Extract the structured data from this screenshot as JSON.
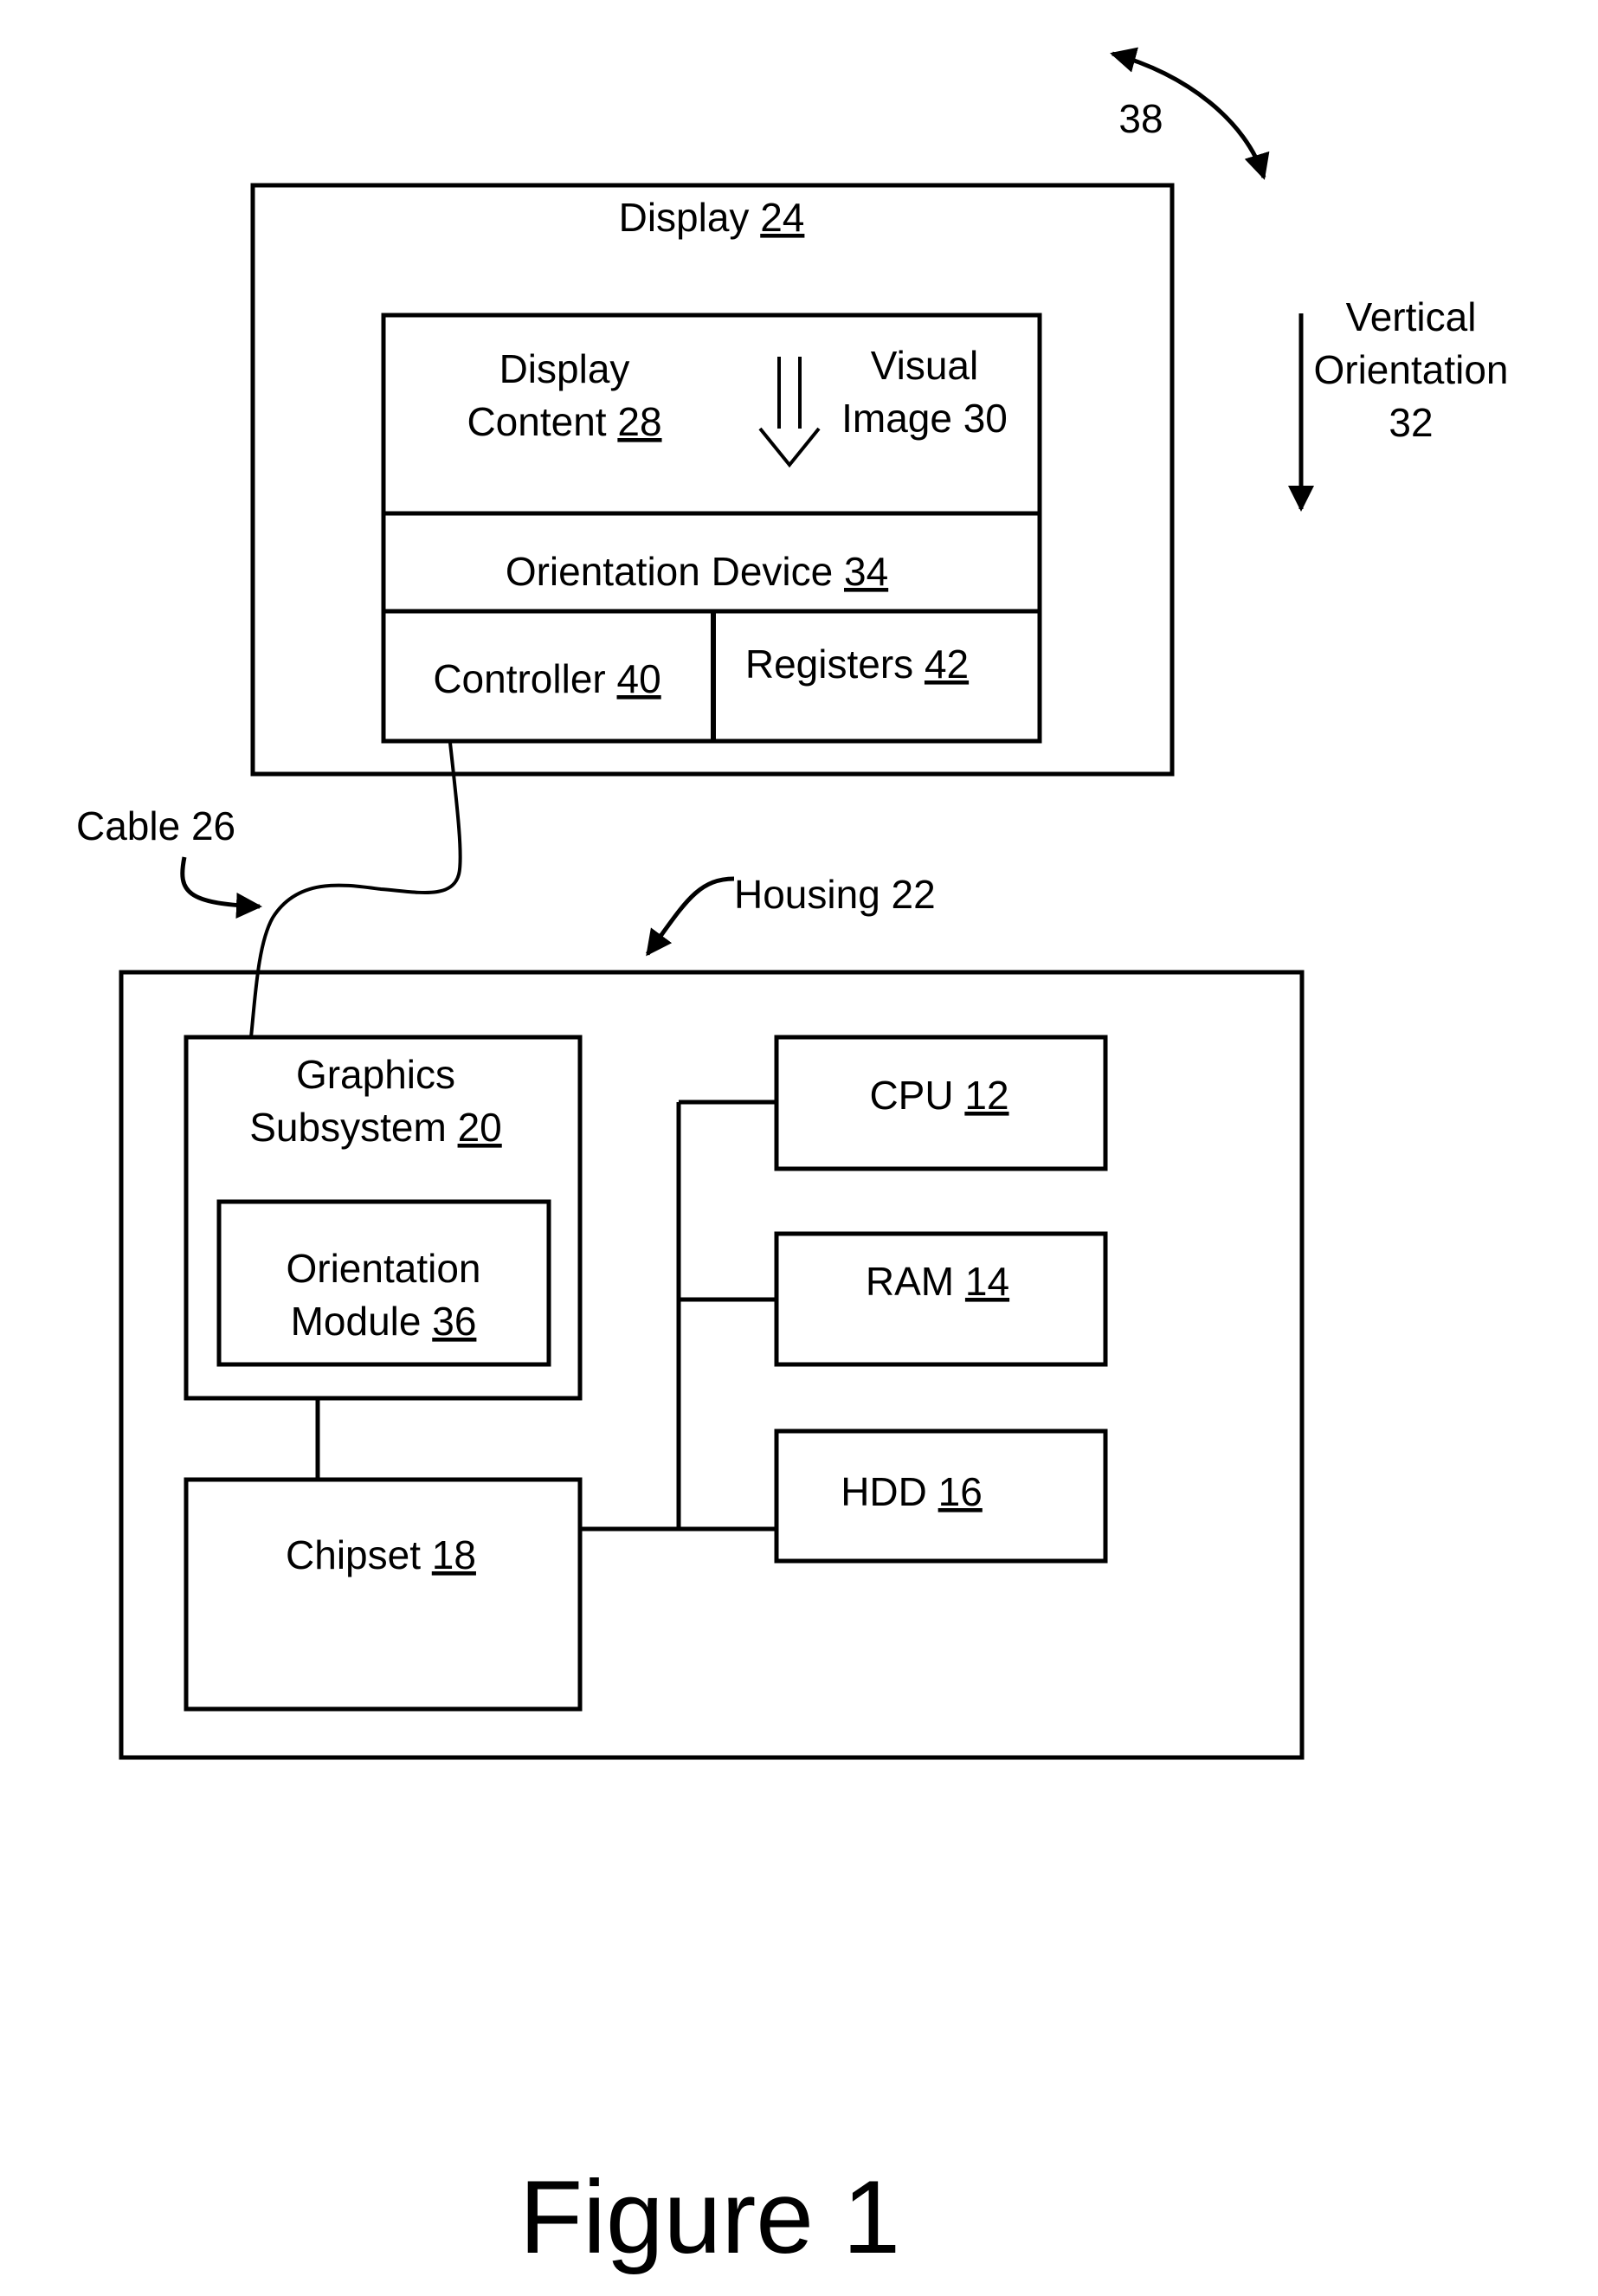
{
  "figure_caption": "Figure 1",
  "colors": {
    "line": "#000000",
    "background": "#ffffff"
  },
  "display": {
    "label": "Display",
    "ref": "24",
    "content": {
      "line1": "Display",
      "line2": "Content",
      "ref": "28"
    },
    "visual_image": {
      "line1": "Visual",
      "line2": "Image 30"
    },
    "orientation_device": {
      "label": "Orientation Device",
      "ref": "34"
    },
    "controller": {
      "label": "Controller",
      "ref": "40"
    },
    "registers": {
      "label": "Registers",
      "ref": "42"
    }
  },
  "rotation": {
    "ref": "38"
  },
  "vertical_orientation": {
    "line1": "Vertical",
    "line2": "Orientation",
    "line3": "32"
  },
  "cable": {
    "label": "Cable 26"
  },
  "housing": {
    "label": "Housing 22",
    "graphics": {
      "line1": "Graphics",
      "line2": "Subsystem",
      "ref": "20"
    },
    "orientation_module": {
      "line1": "Orientation",
      "line2": "Module",
      "ref": "36"
    },
    "chipset": {
      "label": "Chipset",
      "ref": "18"
    },
    "cpu": {
      "label": "CPU",
      "ref": "12"
    },
    "ram": {
      "label": "RAM",
      "ref": "14"
    },
    "hdd": {
      "label": "HDD",
      "ref": "16"
    }
  }
}
